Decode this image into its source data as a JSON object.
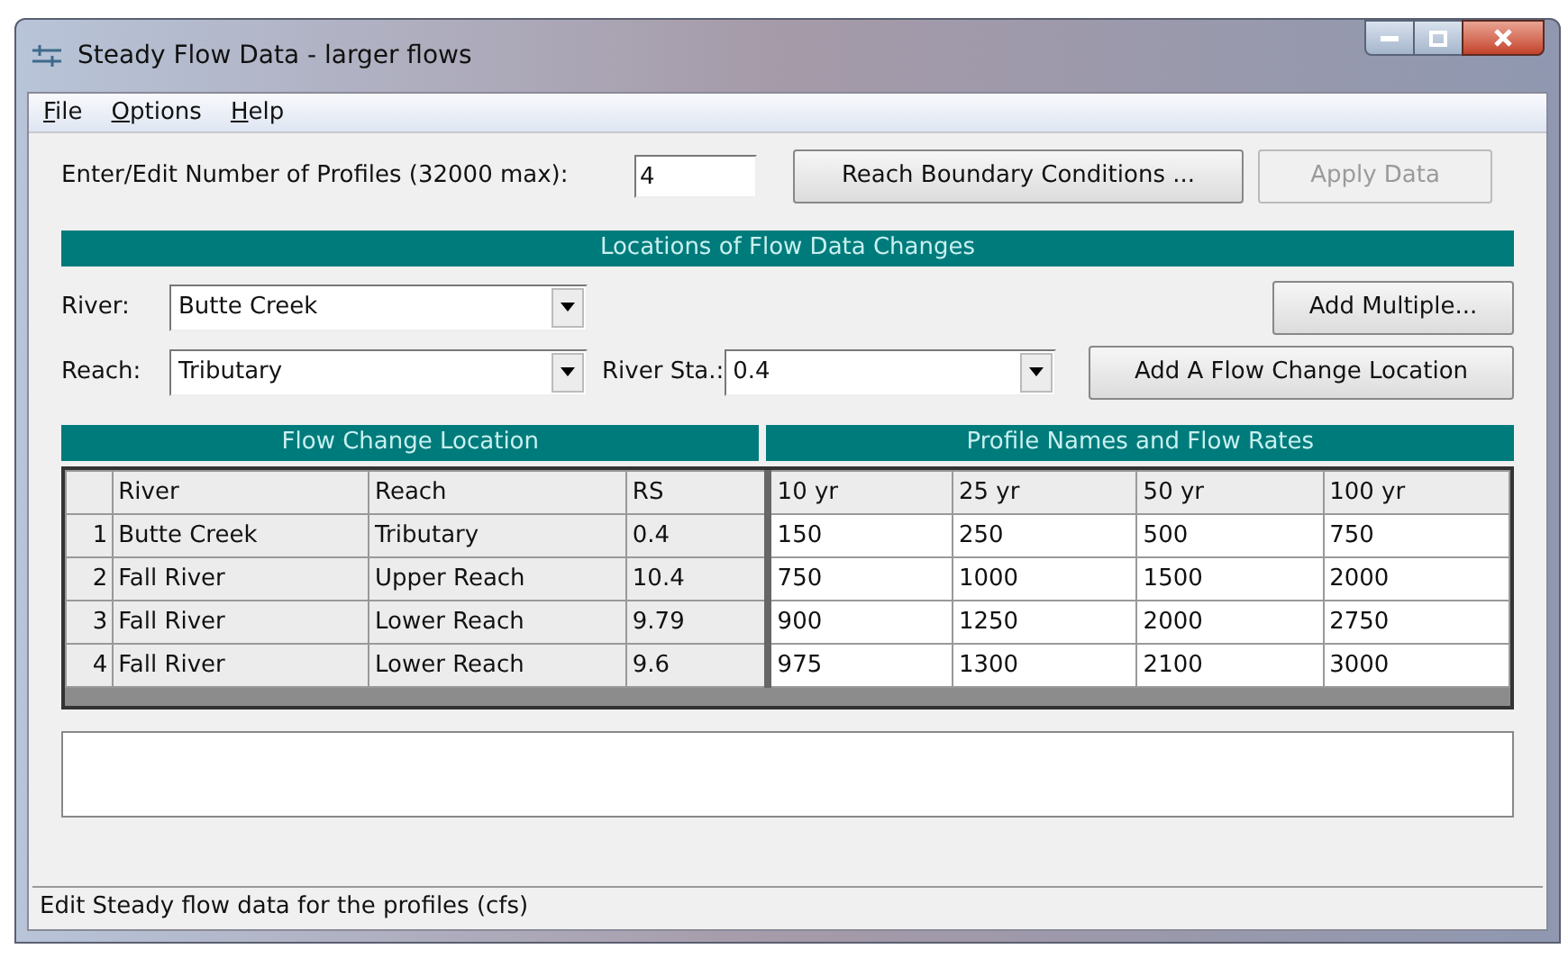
{
  "window": {
    "title": "Steady Flow Data - larger flows"
  },
  "menu": [
    {
      "label": "File"
    },
    {
      "label": "Options"
    },
    {
      "label": "Help"
    }
  ],
  "profiles": {
    "label": "Enter/Edit Number of Profiles (32000 max):",
    "value": "4"
  },
  "top_buttons": [
    {
      "label": "Reach Boundary Conditions ...",
      "disabled": false
    },
    {
      "label": "Apply Data",
      "disabled": true
    }
  ],
  "locations_header": "Locations of Flow Data Changes",
  "river": {
    "label": "River:",
    "value": "Butte Creek"
  },
  "add_multiple": {
    "label": "Add Multiple...",
    "disabled": false
  },
  "reach": {
    "label": "Reach:",
    "value": "Tributary"
  },
  "river_sta": {
    "label": "River Sta.:",
    "value": "0.4"
  },
  "add_location": {
    "label": "Add A Flow Change Location",
    "disabled": false
  },
  "table": {
    "group_headers": [
      "Flow Change Location",
      "Profile Names and Flow Rates"
    ],
    "columns": [
      "River",
      "Reach",
      "RS",
      "10 yr",
      "25 yr",
      "50 yr",
      "100 yr"
    ],
    "rows": [
      {
        "number": "1",
        "cells": [
          "Butte Creek",
          "Tributary",
          "0.4",
          "150",
          "250",
          "500",
          "750"
        ]
      },
      {
        "number": "2",
        "cells": [
          "Fall River",
          "Upper Reach",
          "10.4",
          "750",
          "1000",
          "1500",
          "2000"
        ]
      },
      {
        "number": "3",
        "cells": [
          "Fall River",
          "Lower Reach",
          "9.79",
          "900",
          "1250",
          "2000",
          "2750"
        ]
      },
      {
        "number": "4",
        "cells": [
          "Fall River",
          "Lower Reach",
          "9.6",
          "975",
          "1300",
          "2100",
          "3000"
        ]
      }
    ]
  },
  "status_bar": "Edit Steady flow data for the profiles (cfs)"
}
